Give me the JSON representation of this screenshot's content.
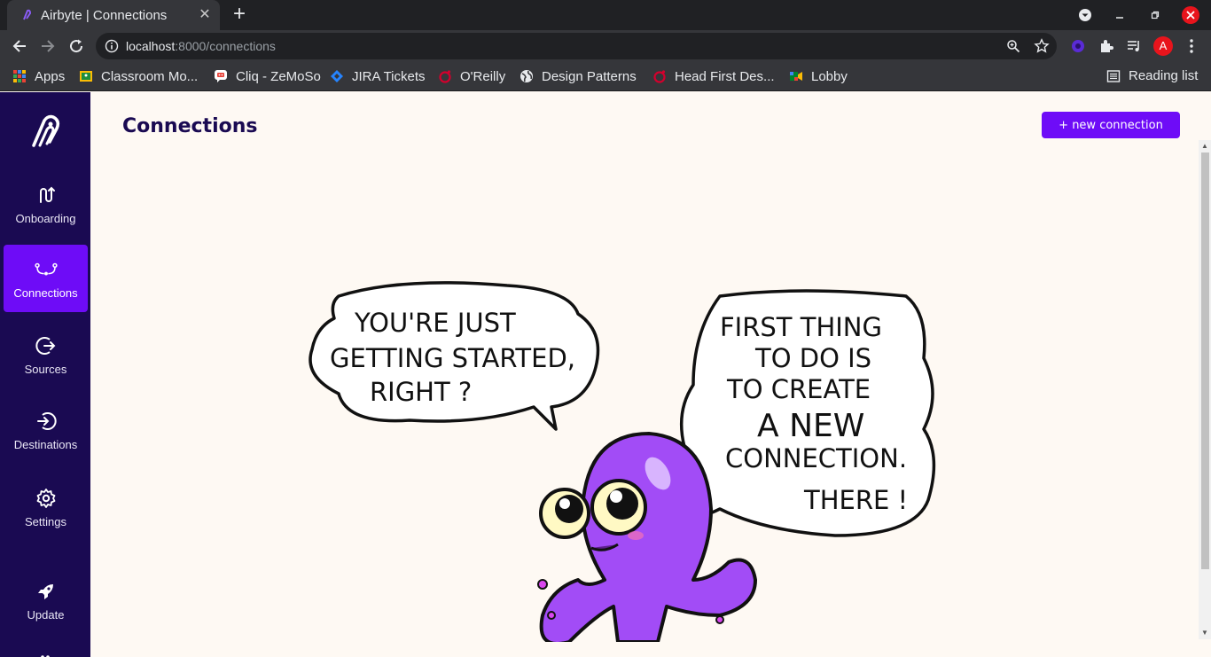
{
  "browser": {
    "tab_title": "Airbyte | Connections",
    "tab_close": "✕",
    "new_tab": "+",
    "url_host": "localhost",
    "url_path": ":8000/connections",
    "profile_initial": "A",
    "bookmarks": [
      {
        "label": "Apps",
        "icon": "apps-grid-icon"
      },
      {
        "label": "Classroom Mo...",
        "icon": "classroom-icon"
      },
      {
        "label": "Cliq - ZeMoSo",
        "icon": "cliq-icon"
      },
      {
        "label": "JIRA Tickets",
        "icon": "jira-icon"
      },
      {
        "label": "O'Reilly",
        "icon": "oreilly-icon"
      },
      {
        "label": "Design Patterns",
        "icon": "globe-icon"
      },
      {
        "label": "Head First Des...",
        "icon": "oreilly-icon"
      },
      {
        "label": "Lobby",
        "icon": "lobby-icon"
      }
    ],
    "reading_list": "Reading list"
  },
  "sidebar": {
    "items": [
      {
        "label": "Onboarding",
        "icon": "onboarding-icon"
      },
      {
        "label": "Connections",
        "icon": "connections-icon",
        "active": true
      },
      {
        "label": "Sources",
        "icon": "sources-icon"
      },
      {
        "label": "Destinations",
        "icon": "destinations-icon"
      },
      {
        "label": "Settings",
        "icon": "gear-icon"
      },
      {
        "label": "Update",
        "icon": "rocket-icon"
      }
    ]
  },
  "main": {
    "title": "Connections",
    "new_button": "+ new connection"
  },
  "illustration": {
    "left_bubble": [
      "YOU'RE JUST",
      "GETTING STARTED,",
      "RIGHT ?"
    ],
    "right_bubble": [
      "FIRST THING",
      "TO DO IS",
      "TO CREATE",
      "A NEW",
      "CONNECTION.",
      "THERE !"
    ]
  },
  "colors": {
    "brand": "#6e0cf7",
    "sidebar": "#1a0a52",
    "background": "#fef9f3"
  }
}
